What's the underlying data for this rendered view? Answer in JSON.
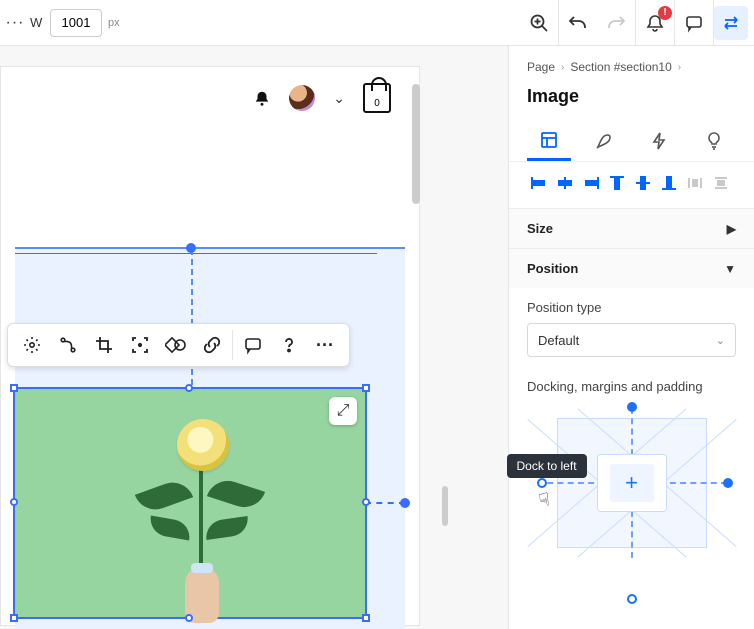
{
  "topbar": {
    "width_label": "W",
    "width_value": "1001",
    "width_unit": "px",
    "alert_badge": "!"
  },
  "breadcrumbs": {
    "page": "Page",
    "section": "Section #section10"
  },
  "inspector": {
    "title": "Image",
    "size_label": "Size",
    "position_label": "Position",
    "position_type_label": "Position type",
    "position_type_value": "Default",
    "dock_label": "Docking, margins and padding",
    "dock_tooltip": "Dock to left",
    "add_glyph": "+"
  },
  "site": {
    "bag_count": "0"
  },
  "icons": {
    "dots": "···",
    "chevron_right": "›",
    "chevron_down": "⌄",
    "triangle_right": "▶",
    "triangle_down": "▼",
    "expand": "⤢",
    "cursor": "☟"
  }
}
